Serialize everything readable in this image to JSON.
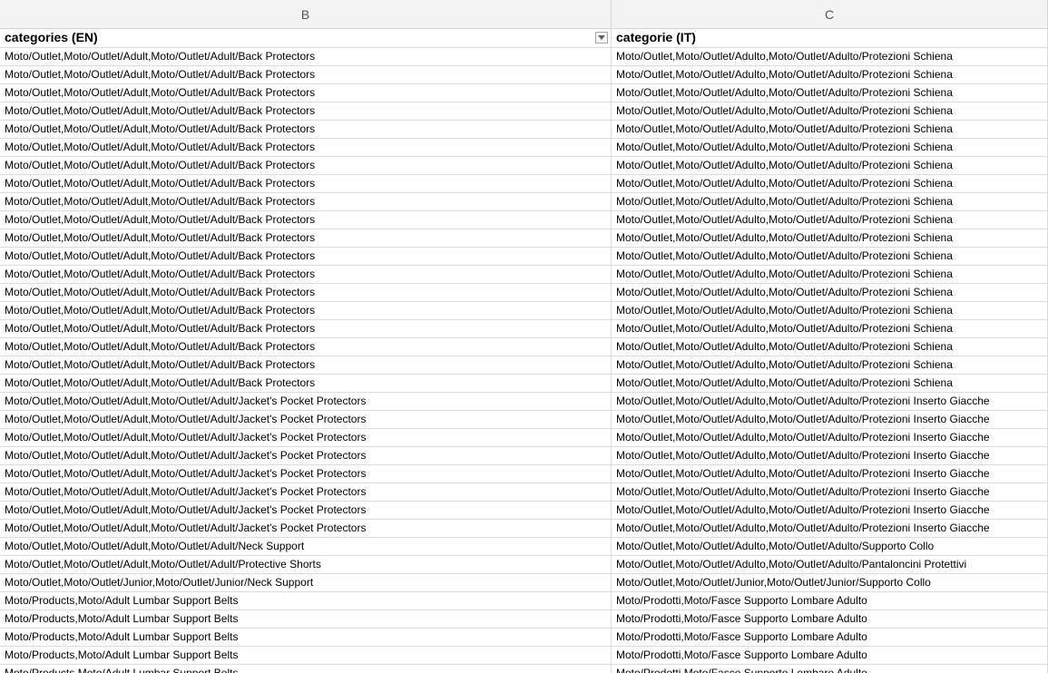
{
  "column_headers": {
    "B": "B",
    "C": "C"
  },
  "header": {
    "en": "categories (EN)",
    "it": "categorie (IT)"
  },
  "rows": [
    {
      "en": "Moto/Outlet,Moto/Outlet/Adult,Moto/Outlet/Adult/Back Protectors",
      "it": "Moto/Outlet,Moto/Outlet/Adulto,Moto/Outlet/Adulto/Protezioni Schiena"
    },
    {
      "en": "Moto/Outlet,Moto/Outlet/Adult,Moto/Outlet/Adult/Back Protectors",
      "it": "Moto/Outlet,Moto/Outlet/Adulto,Moto/Outlet/Adulto/Protezioni Schiena"
    },
    {
      "en": "Moto/Outlet,Moto/Outlet/Adult,Moto/Outlet/Adult/Back Protectors",
      "it": "Moto/Outlet,Moto/Outlet/Adulto,Moto/Outlet/Adulto/Protezioni Schiena"
    },
    {
      "en": "Moto/Outlet,Moto/Outlet/Adult,Moto/Outlet/Adult/Back Protectors",
      "it": "Moto/Outlet,Moto/Outlet/Adulto,Moto/Outlet/Adulto/Protezioni Schiena"
    },
    {
      "en": "Moto/Outlet,Moto/Outlet/Adult,Moto/Outlet/Adult/Back Protectors",
      "it": "Moto/Outlet,Moto/Outlet/Adulto,Moto/Outlet/Adulto/Protezioni Schiena"
    },
    {
      "en": "Moto/Outlet,Moto/Outlet/Adult,Moto/Outlet/Adult/Back Protectors",
      "it": "Moto/Outlet,Moto/Outlet/Adulto,Moto/Outlet/Adulto/Protezioni Schiena"
    },
    {
      "en": "Moto/Outlet,Moto/Outlet/Adult,Moto/Outlet/Adult/Back Protectors",
      "it": "Moto/Outlet,Moto/Outlet/Adulto,Moto/Outlet/Adulto/Protezioni Schiena"
    },
    {
      "en": "Moto/Outlet,Moto/Outlet/Adult,Moto/Outlet/Adult/Back Protectors",
      "it": "Moto/Outlet,Moto/Outlet/Adulto,Moto/Outlet/Adulto/Protezioni Schiena"
    },
    {
      "en": "Moto/Outlet,Moto/Outlet/Adult,Moto/Outlet/Adult/Back Protectors",
      "it": "Moto/Outlet,Moto/Outlet/Adulto,Moto/Outlet/Adulto/Protezioni Schiena"
    },
    {
      "en": "Moto/Outlet,Moto/Outlet/Adult,Moto/Outlet/Adult/Back Protectors",
      "it": "Moto/Outlet,Moto/Outlet/Adulto,Moto/Outlet/Adulto/Protezioni Schiena"
    },
    {
      "en": "Moto/Outlet,Moto/Outlet/Adult,Moto/Outlet/Adult/Back Protectors",
      "it": "Moto/Outlet,Moto/Outlet/Adulto,Moto/Outlet/Adulto/Protezioni Schiena"
    },
    {
      "en": "Moto/Outlet,Moto/Outlet/Adult,Moto/Outlet/Adult/Back Protectors",
      "it": "Moto/Outlet,Moto/Outlet/Adulto,Moto/Outlet/Adulto/Protezioni Schiena"
    },
    {
      "en": "Moto/Outlet,Moto/Outlet/Adult,Moto/Outlet/Adult/Back Protectors",
      "it": "Moto/Outlet,Moto/Outlet/Adulto,Moto/Outlet/Adulto/Protezioni Schiena"
    },
    {
      "en": "Moto/Outlet,Moto/Outlet/Adult,Moto/Outlet/Adult/Back Protectors",
      "it": "Moto/Outlet,Moto/Outlet/Adulto,Moto/Outlet/Adulto/Protezioni Schiena"
    },
    {
      "en": "Moto/Outlet,Moto/Outlet/Adult,Moto/Outlet/Adult/Back Protectors",
      "it": "Moto/Outlet,Moto/Outlet/Adulto,Moto/Outlet/Adulto/Protezioni Schiena"
    },
    {
      "en": "Moto/Outlet,Moto/Outlet/Adult,Moto/Outlet/Adult/Back Protectors",
      "it": "Moto/Outlet,Moto/Outlet/Adulto,Moto/Outlet/Adulto/Protezioni Schiena"
    },
    {
      "en": "Moto/Outlet,Moto/Outlet/Adult,Moto/Outlet/Adult/Back Protectors",
      "it": "Moto/Outlet,Moto/Outlet/Adulto,Moto/Outlet/Adulto/Protezioni Schiena"
    },
    {
      "en": "Moto/Outlet,Moto/Outlet/Adult,Moto/Outlet/Adult/Back Protectors",
      "it": "Moto/Outlet,Moto/Outlet/Adulto,Moto/Outlet/Adulto/Protezioni Schiena"
    },
    {
      "en": "Moto/Outlet,Moto/Outlet/Adult,Moto/Outlet/Adult/Back Protectors",
      "it": "Moto/Outlet,Moto/Outlet/Adulto,Moto/Outlet/Adulto/Protezioni Schiena"
    },
    {
      "en": "Moto/Outlet,Moto/Outlet/Adult,Moto/Outlet/Adult/Jacket's Pocket Protectors",
      "it": "Moto/Outlet,Moto/Outlet/Adulto,Moto/Outlet/Adulto/Protezioni Inserto Giacche"
    },
    {
      "en": "Moto/Outlet,Moto/Outlet/Adult,Moto/Outlet/Adult/Jacket's Pocket Protectors",
      "it": "Moto/Outlet,Moto/Outlet/Adulto,Moto/Outlet/Adulto/Protezioni Inserto Giacche"
    },
    {
      "en": "Moto/Outlet,Moto/Outlet/Adult,Moto/Outlet/Adult/Jacket's Pocket Protectors",
      "it": "Moto/Outlet,Moto/Outlet/Adulto,Moto/Outlet/Adulto/Protezioni Inserto Giacche"
    },
    {
      "en": "Moto/Outlet,Moto/Outlet/Adult,Moto/Outlet/Adult/Jacket's Pocket Protectors",
      "it": "Moto/Outlet,Moto/Outlet/Adulto,Moto/Outlet/Adulto/Protezioni Inserto Giacche"
    },
    {
      "en": "Moto/Outlet,Moto/Outlet/Adult,Moto/Outlet/Adult/Jacket's Pocket Protectors",
      "it": "Moto/Outlet,Moto/Outlet/Adulto,Moto/Outlet/Adulto/Protezioni Inserto Giacche"
    },
    {
      "en": "Moto/Outlet,Moto/Outlet/Adult,Moto/Outlet/Adult/Jacket's Pocket Protectors",
      "it": "Moto/Outlet,Moto/Outlet/Adulto,Moto/Outlet/Adulto/Protezioni Inserto Giacche"
    },
    {
      "en": "Moto/Outlet,Moto/Outlet/Adult,Moto/Outlet/Adult/Jacket's Pocket Protectors",
      "it": "Moto/Outlet,Moto/Outlet/Adulto,Moto/Outlet/Adulto/Protezioni Inserto Giacche"
    },
    {
      "en": "Moto/Outlet,Moto/Outlet/Adult,Moto/Outlet/Adult/Jacket's Pocket Protectors",
      "it": "Moto/Outlet,Moto/Outlet/Adulto,Moto/Outlet/Adulto/Protezioni Inserto Giacche"
    },
    {
      "en": "Moto/Outlet,Moto/Outlet/Adult,Moto/Outlet/Adult/Neck Support",
      "it": "Moto/Outlet,Moto/Outlet/Adulto,Moto/Outlet/Adulto/Supporto Collo"
    },
    {
      "en": "Moto/Outlet,Moto/Outlet/Adult,Moto/Outlet/Adult/Protective Shorts",
      "it": "Moto/Outlet,Moto/Outlet/Adulto,Moto/Outlet/Adulto/Pantaloncini Protettivi"
    },
    {
      "en": "Moto/Outlet,Moto/Outlet/Junior,Moto/Outlet/Junior/Neck Support",
      "it": "Moto/Outlet,Moto/Outlet/Junior,Moto/Outlet/Junior/Supporto Collo"
    },
    {
      "en": "Moto/Products,Moto/Adult Lumbar Support Belts",
      "it": "Moto/Prodotti,Moto/Fasce Supporto Lombare Adulto"
    },
    {
      "en": "Moto/Products,Moto/Adult Lumbar Support Belts",
      "it": "Moto/Prodotti,Moto/Fasce Supporto Lombare Adulto"
    },
    {
      "en": "Moto/Products,Moto/Adult Lumbar Support Belts",
      "it": "Moto/Prodotti,Moto/Fasce Supporto Lombare Adulto"
    },
    {
      "en": "Moto/Products,Moto/Adult Lumbar Support Belts",
      "it": "Moto/Prodotti,Moto/Fasce Supporto Lombare Adulto"
    },
    {
      "en": "Moto/Products,Moto/Adult Lumbar Support Belts",
      "it": "Moto/Prodotti,Moto/Fasce Supporto Lombare Adulto"
    }
  ]
}
